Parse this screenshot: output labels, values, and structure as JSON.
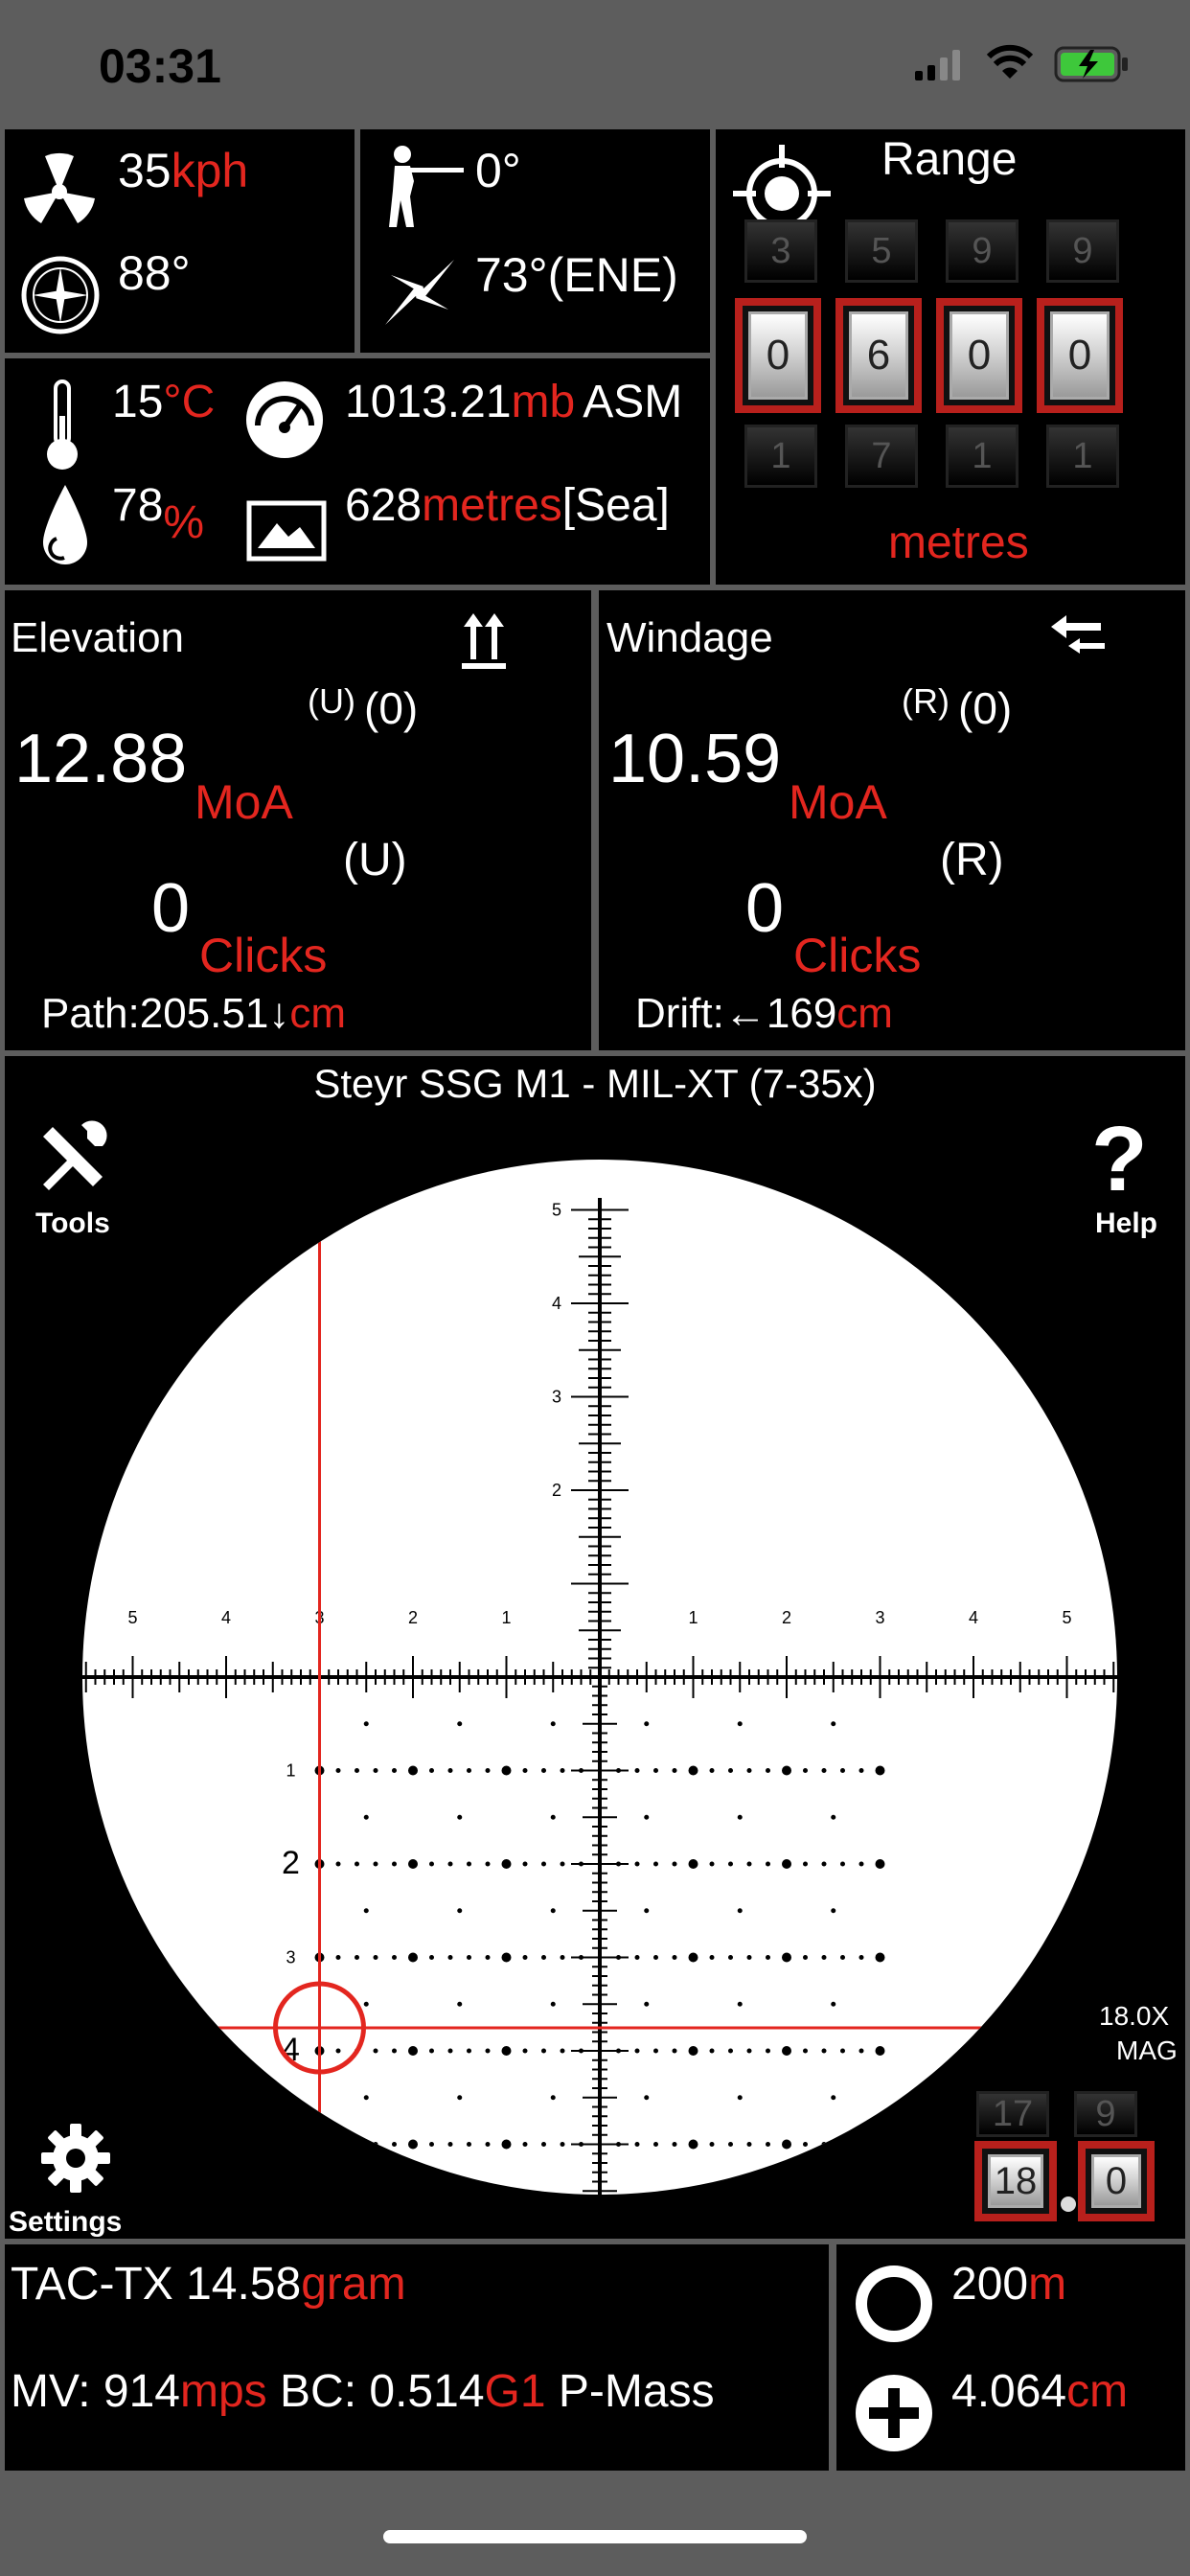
{
  "status_bar": {
    "time": "03:31"
  },
  "environment": {
    "wind_speed": "35",
    "wind_speed_unit": "kph",
    "wind_direction": "88°",
    "shot_angle": "0°",
    "heading": "73°(ENE)",
    "temperature": "15",
    "temperature_unit": "°C",
    "humidity": "78",
    "humidity_unit": "%",
    "pressure": "1013.21",
    "pressure_unit": "mb",
    "pressure_suffix": "ASM",
    "altitude": "628",
    "altitude_unit": "metres",
    "altitude_suffix": "[Sea]"
  },
  "range": {
    "title": "Range",
    "digits": [
      "0",
      "6",
      "0",
      "0"
    ],
    "above": [
      "3",
      "5",
      "9",
      "9"
    ],
    "below": [
      "1",
      "7",
      "1",
      "1"
    ],
    "unit": "metres"
  },
  "elevation": {
    "title": "Elevation",
    "dir": "(U)",
    "dir_clicks": "(0)",
    "value": "12.88",
    "unit": "MoA",
    "clicks_dir": "(U)",
    "clicks": "0",
    "clicks_label": "Clicks",
    "path_label": "Path:205.51↓",
    "path_unit": "cm"
  },
  "windage": {
    "title": "Windage",
    "dir": "(R)",
    "dir_clicks": "(0)",
    "value": "10.59",
    "unit": "MoA",
    "clicks_dir": "(R)",
    "clicks": "0",
    "clicks_label": "Clicks",
    "drift_label": "Drift:←169",
    "drift_unit": "cm"
  },
  "scope": {
    "title": "Steyr SSG M1 - MIL-XT (7-35x)",
    "tools_label": "Tools",
    "help_label": "Help",
    "settings_label": "Settings",
    "mag_value": "18.0X",
    "mag_label": "MAG",
    "mag_digits": [
      "18",
      "0"
    ],
    "mag_above": [
      "17",
      "9"
    ],
    "tick_labels_h": [
      "5",
      "4",
      "3",
      "2",
      "1",
      "1",
      "2",
      "3",
      "4",
      "5"
    ],
    "tick_labels_v": [
      "5",
      "4",
      "3",
      "2"
    ],
    "tick_labels_lower": [
      "1",
      "2",
      "3",
      "4"
    ]
  },
  "ammo": {
    "name": "TAC-TX",
    "weight": "14.58",
    "weight_unit": "gram",
    "mv_label": "MV:",
    "mv": "914",
    "mv_unit": "mps",
    "bc_label": "BC:",
    "bc": "0.514",
    "bc_model": "G1",
    "bc_suffix": "P-Mass"
  },
  "zero": {
    "distance": "200",
    "distance_unit": "m",
    "sight_height": "4.064",
    "sight_height_unit": "cm"
  },
  "colors": {
    "accent": "#e3261f",
    "panel": "#000000",
    "frame": "#5d5d5d"
  }
}
